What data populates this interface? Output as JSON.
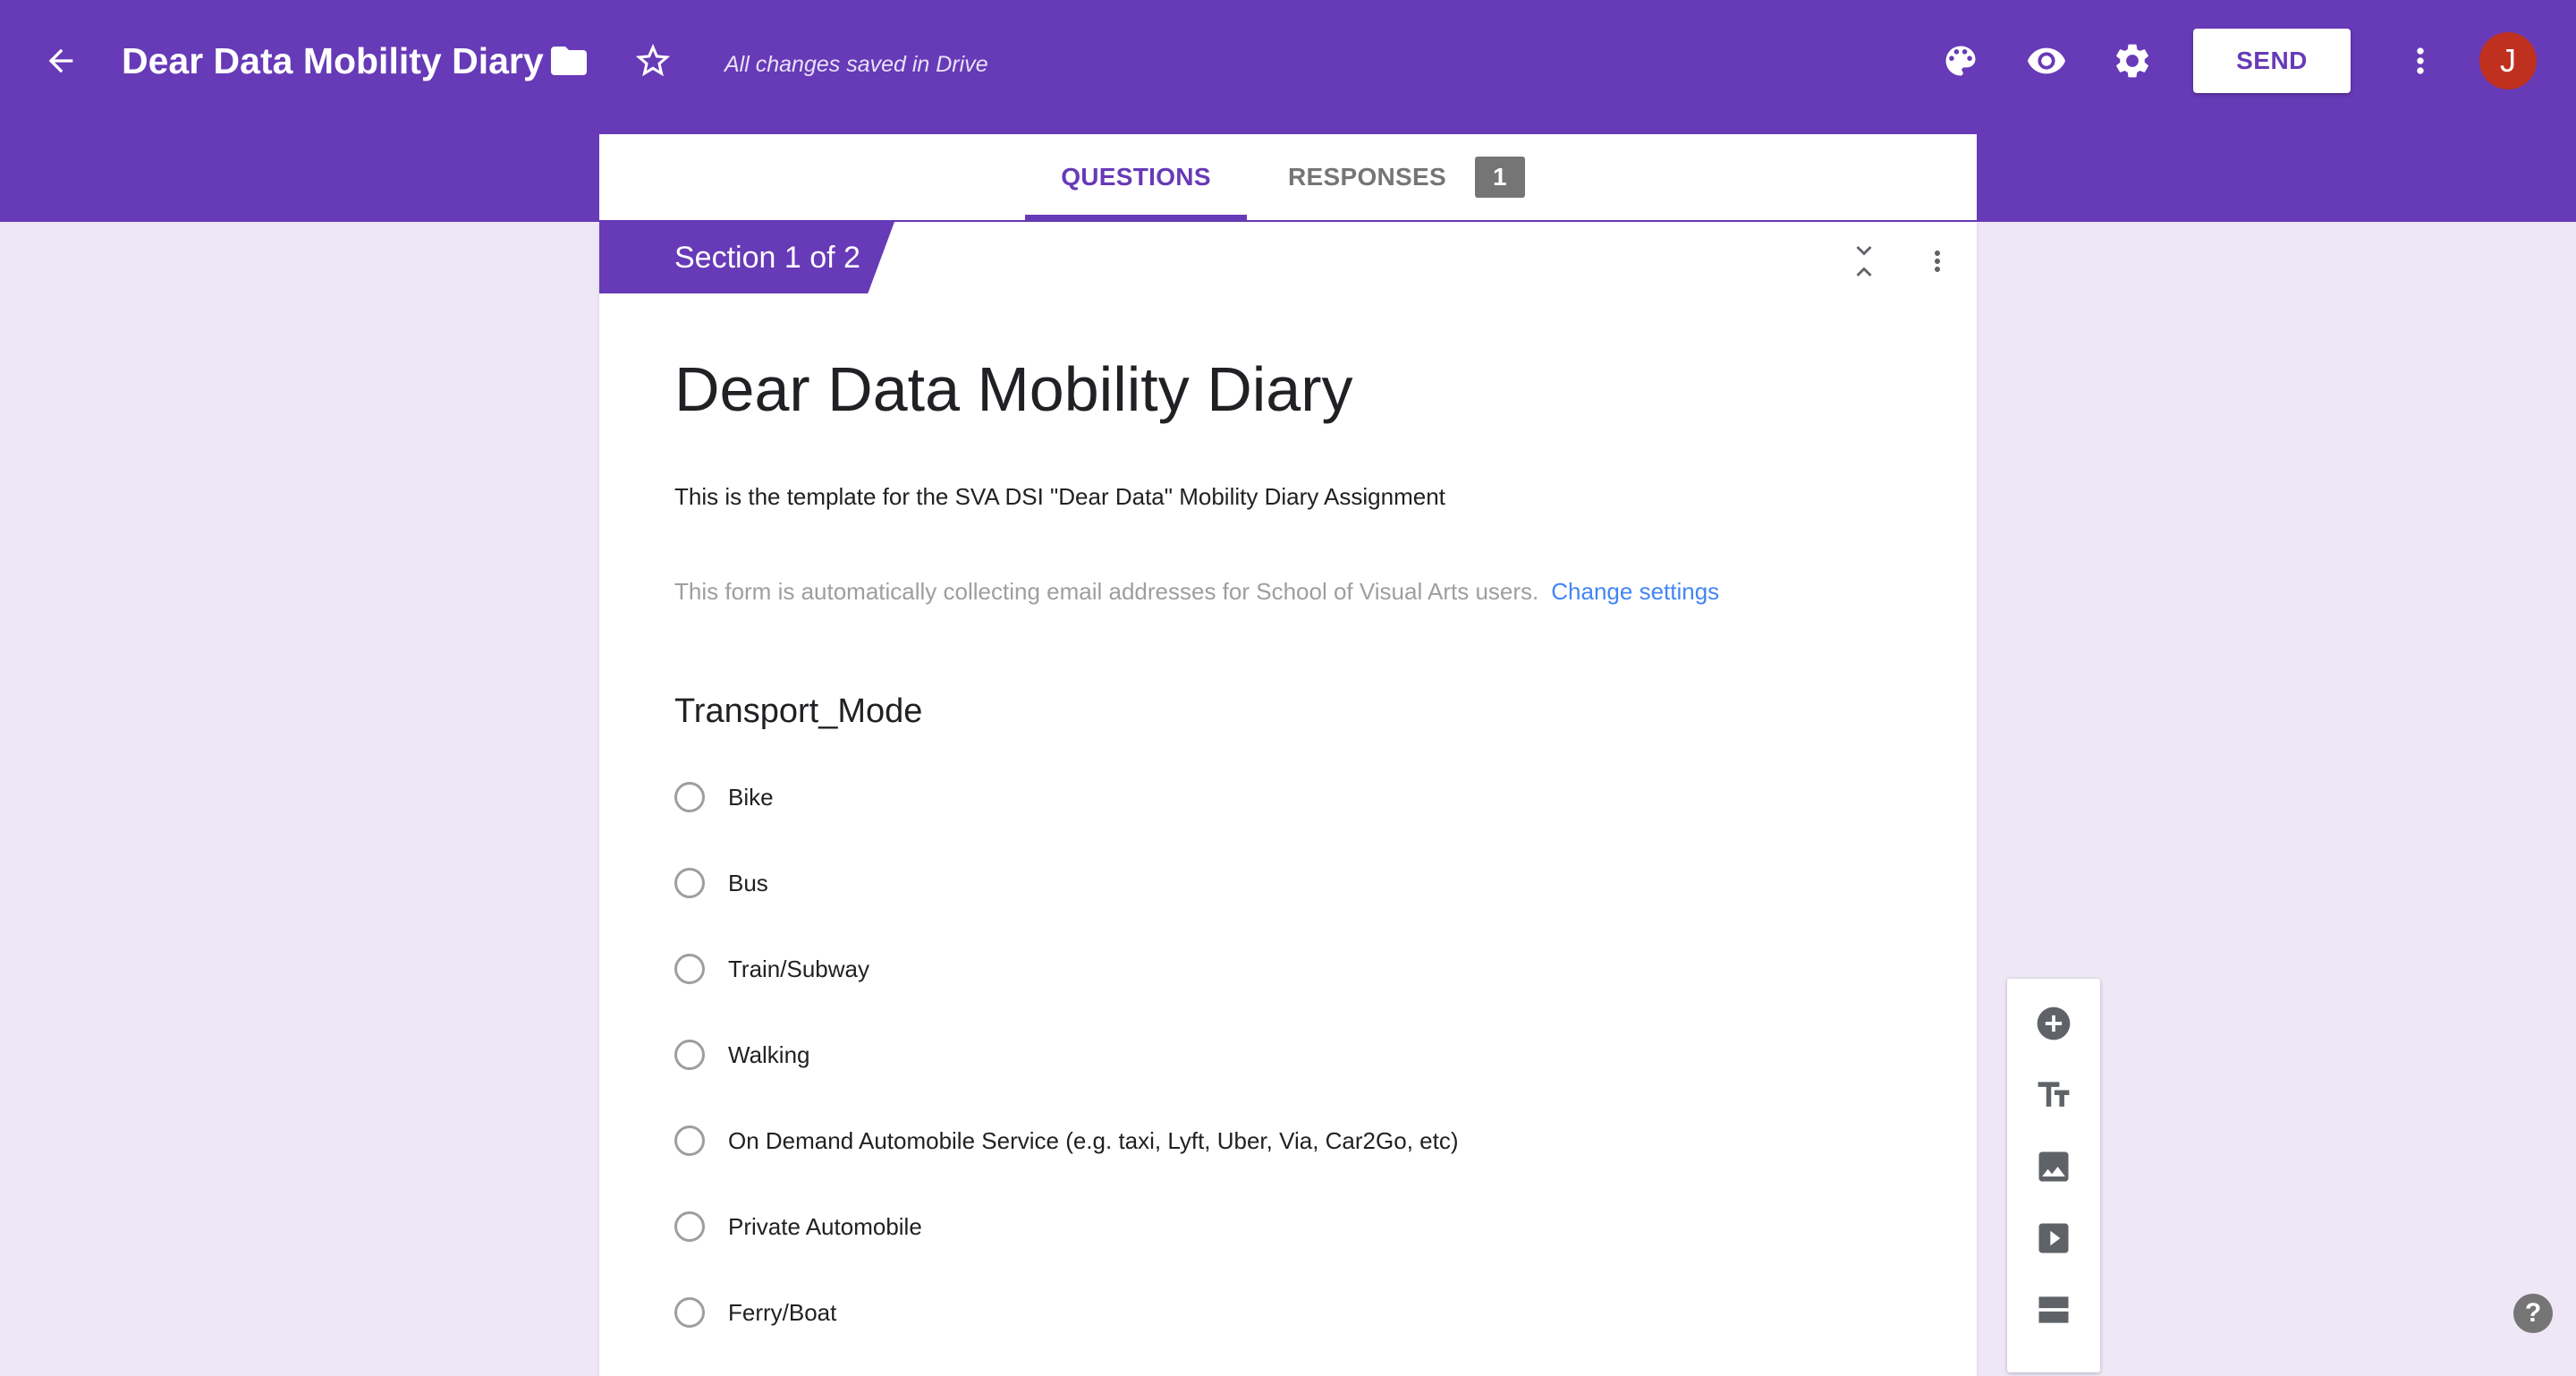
{
  "header": {
    "form_title": "Dear Data Mobility Diary",
    "saved_status": "All changes saved in Drive",
    "send_label": "SEND",
    "avatar_initial": "J"
  },
  "tabs": {
    "questions": "QUESTIONS",
    "responses": "RESPONSES",
    "responses_count": "1"
  },
  "section": {
    "label": "Section 1 of 2"
  },
  "form": {
    "title": "Dear Data Mobility Diary",
    "description": "This is the template for the SVA DSI \"Dear Data\" Mobility Diary Assignment",
    "email_note": "This form is automatically collecting email addresses for School of Visual Arts users.",
    "change_settings": "Change settings"
  },
  "question": {
    "title": "Transport_Mode",
    "options": [
      "Bike",
      "Bus",
      "Train/Subway",
      "Walking",
      "On Demand Automobile Service (e.g. taxi, Lyft, Uber, Via, Car2Go, etc)",
      "Private Automobile",
      "Ferry/Boat"
    ]
  },
  "help_label": "?",
  "colors": {
    "brand": "#673ab7",
    "background": "#ede7f6",
    "link": "#4285f4",
    "avatar": "#c0301e"
  }
}
